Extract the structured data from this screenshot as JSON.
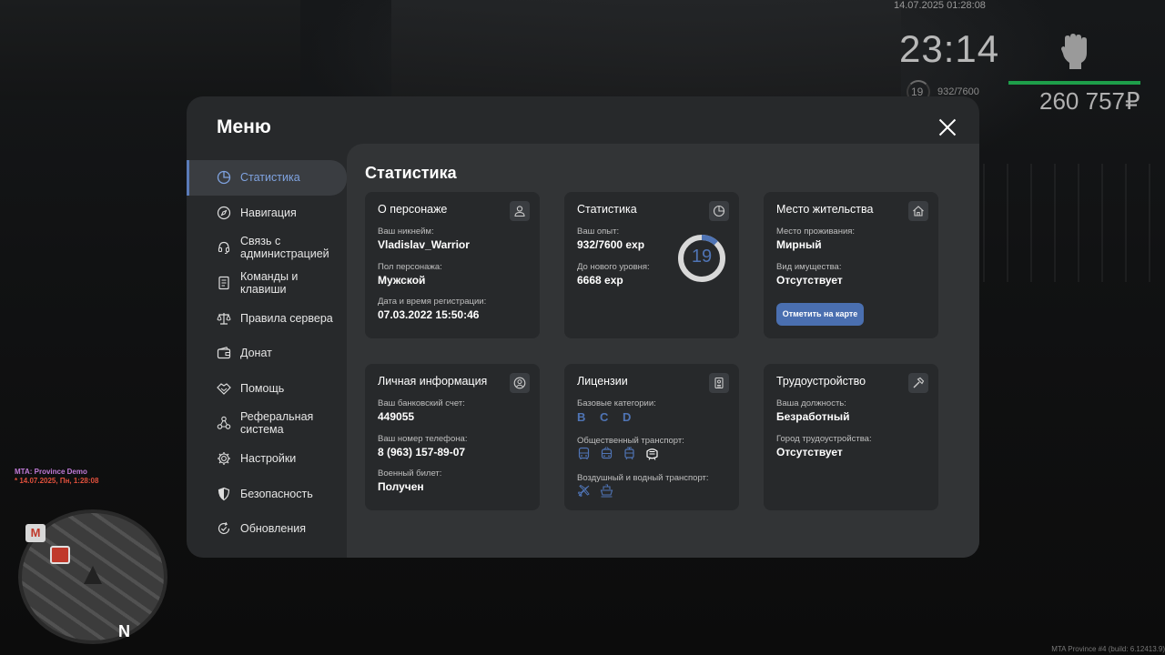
{
  "hud": {
    "datetime": "14.07.2025 01:28:08",
    "clock": "23:14",
    "level": "19",
    "exp": "932/7600",
    "money": "260 757₽",
    "health_fraction": 1.0
  },
  "server": {
    "name": "MTA: Province Demo",
    "date": "* 14.07.2025, Пн, 1:28:08",
    "build": "MTA Province #4 (build: 6.12413.9)"
  },
  "minimap": {
    "metro_label": "М",
    "north_label": "N"
  },
  "menu": {
    "title": "Меню",
    "sidebar": {
      "items": [
        {
          "label": "Статистика",
          "icon": "pie-chart-icon"
        },
        {
          "label": "Навигация",
          "icon": "compass-icon"
        },
        {
          "label": "Связь с администрацией",
          "icon": "headset-icon"
        },
        {
          "label": "Команды и клавиши",
          "icon": "keyboard-icon"
        },
        {
          "label": "Правила сервера",
          "icon": "scales-icon"
        },
        {
          "label": "Донат",
          "icon": "wallet-icon"
        },
        {
          "label": "Помощь",
          "icon": "handshake-icon"
        },
        {
          "label": "Реферальная система",
          "icon": "network-icon"
        },
        {
          "label": "Настройки",
          "icon": "gear-icon"
        },
        {
          "label": "Безопасность",
          "icon": "shield-icon"
        },
        {
          "label": "Обновления",
          "icon": "refresh-check-icon"
        }
      ]
    },
    "content": {
      "title": "Статистика",
      "character": {
        "title": "О персонаже",
        "nickname_label": "Ваш никнейм:",
        "nickname": "Vladislav_Warrior",
        "gender_label": "Пол персонажа:",
        "gender": "Мужской",
        "reg_label": "Дата и время регистрации:",
        "reg_date": "07.03.2022 15:50:46"
      },
      "stats": {
        "title": "Статистика",
        "exp_label": "Ваш опыт:",
        "exp": "932/7600 exp",
        "next_label": "До нового уровня:",
        "next": "6668 exp",
        "level": "19",
        "level_progress": 0.12
      },
      "residence": {
        "title": "Место жительства",
        "place_label": "Место проживания:",
        "place": "Мирный",
        "property_label": "Вид имущества:",
        "property": "Отсутствует",
        "button": "Отметить на карте"
      },
      "personal": {
        "title": "Личная информация",
        "bank_label": "Ваш банковский счет:",
        "bank": "449055",
        "phone_label": "Ваш номер телефона:",
        "phone": "8 (963) 157-89-07",
        "military_label": "Военный билет:",
        "military": "Получен"
      },
      "licenses": {
        "title": "Лицензии",
        "basic_label": "Базовые категории:",
        "basic": "B C D",
        "public_label": "Общественный транспорт:",
        "public_icons": [
          "bus-icon",
          "trolleybus-icon",
          "tram-icon",
          "metro-icon"
        ],
        "air_label": "Воздушный и водный транспорт:",
        "air_icons": [
          "plane-icon",
          "boat-icon"
        ]
      },
      "employment": {
        "title": "Трудоустройство",
        "position_label": "Ваша должность:",
        "position": "Безработный",
        "city_label": "Город трудоустройства:",
        "city": "Отсутствует"
      }
    }
  },
  "colors": {
    "accent": "#4f74b5",
    "health": "#1e9e4a",
    "panel": "#27292b",
    "content": "#323436"
  }
}
